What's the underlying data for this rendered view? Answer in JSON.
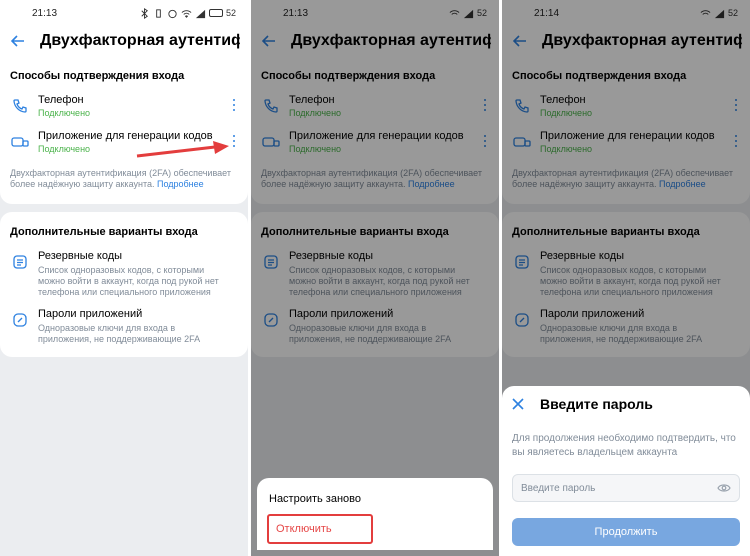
{
  "status": {
    "time1": "21:13",
    "time2": "21:13",
    "time3": "21:14",
    "battery": "52"
  },
  "page": {
    "title": "Двухфакторная аутентифика"
  },
  "methods": {
    "section_title": "Способы подтверждения входа",
    "phone": {
      "title": "Телефон",
      "status": "Подключено"
    },
    "app": {
      "title": "Приложение для генерации кодов",
      "status": "Подключено"
    },
    "note": "Двухфакторная аутентификация (2FA) обеспечивает более надёжную защиту аккаунта.",
    "note_link": "Подробнее"
  },
  "extra": {
    "section_title": "Дополнительные варианты входа",
    "backup": {
      "title": "Резервные коды",
      "desc": "Список одноразовых кодов, с которыми можно войти в аккаунт, когда под рукой нет телефона или специального приложения"
    },
    "apppass": {
      "title": "Пароли приложений",
      "desc": "Одноразовые ключи для входа в приложения, не поддерживающие 2FA"
    }
  },
  "menu": {
    "reset": "Настроить заново",
    "disable": "Отключить"
  },
  "password_dialog": {
    "title": "Введите пароль",
    "desc": "Для продолжения необходимо подтвердить, что вы являетесь владельцем аккаунта",
    "placeholder": "Введите пароль",
    "continue": "Продолжить"
  },
  "colors": {
    "accent": "#2d81e0",
    "success": "#4bb34b",
    "danger": "#e64646"
  }
}
